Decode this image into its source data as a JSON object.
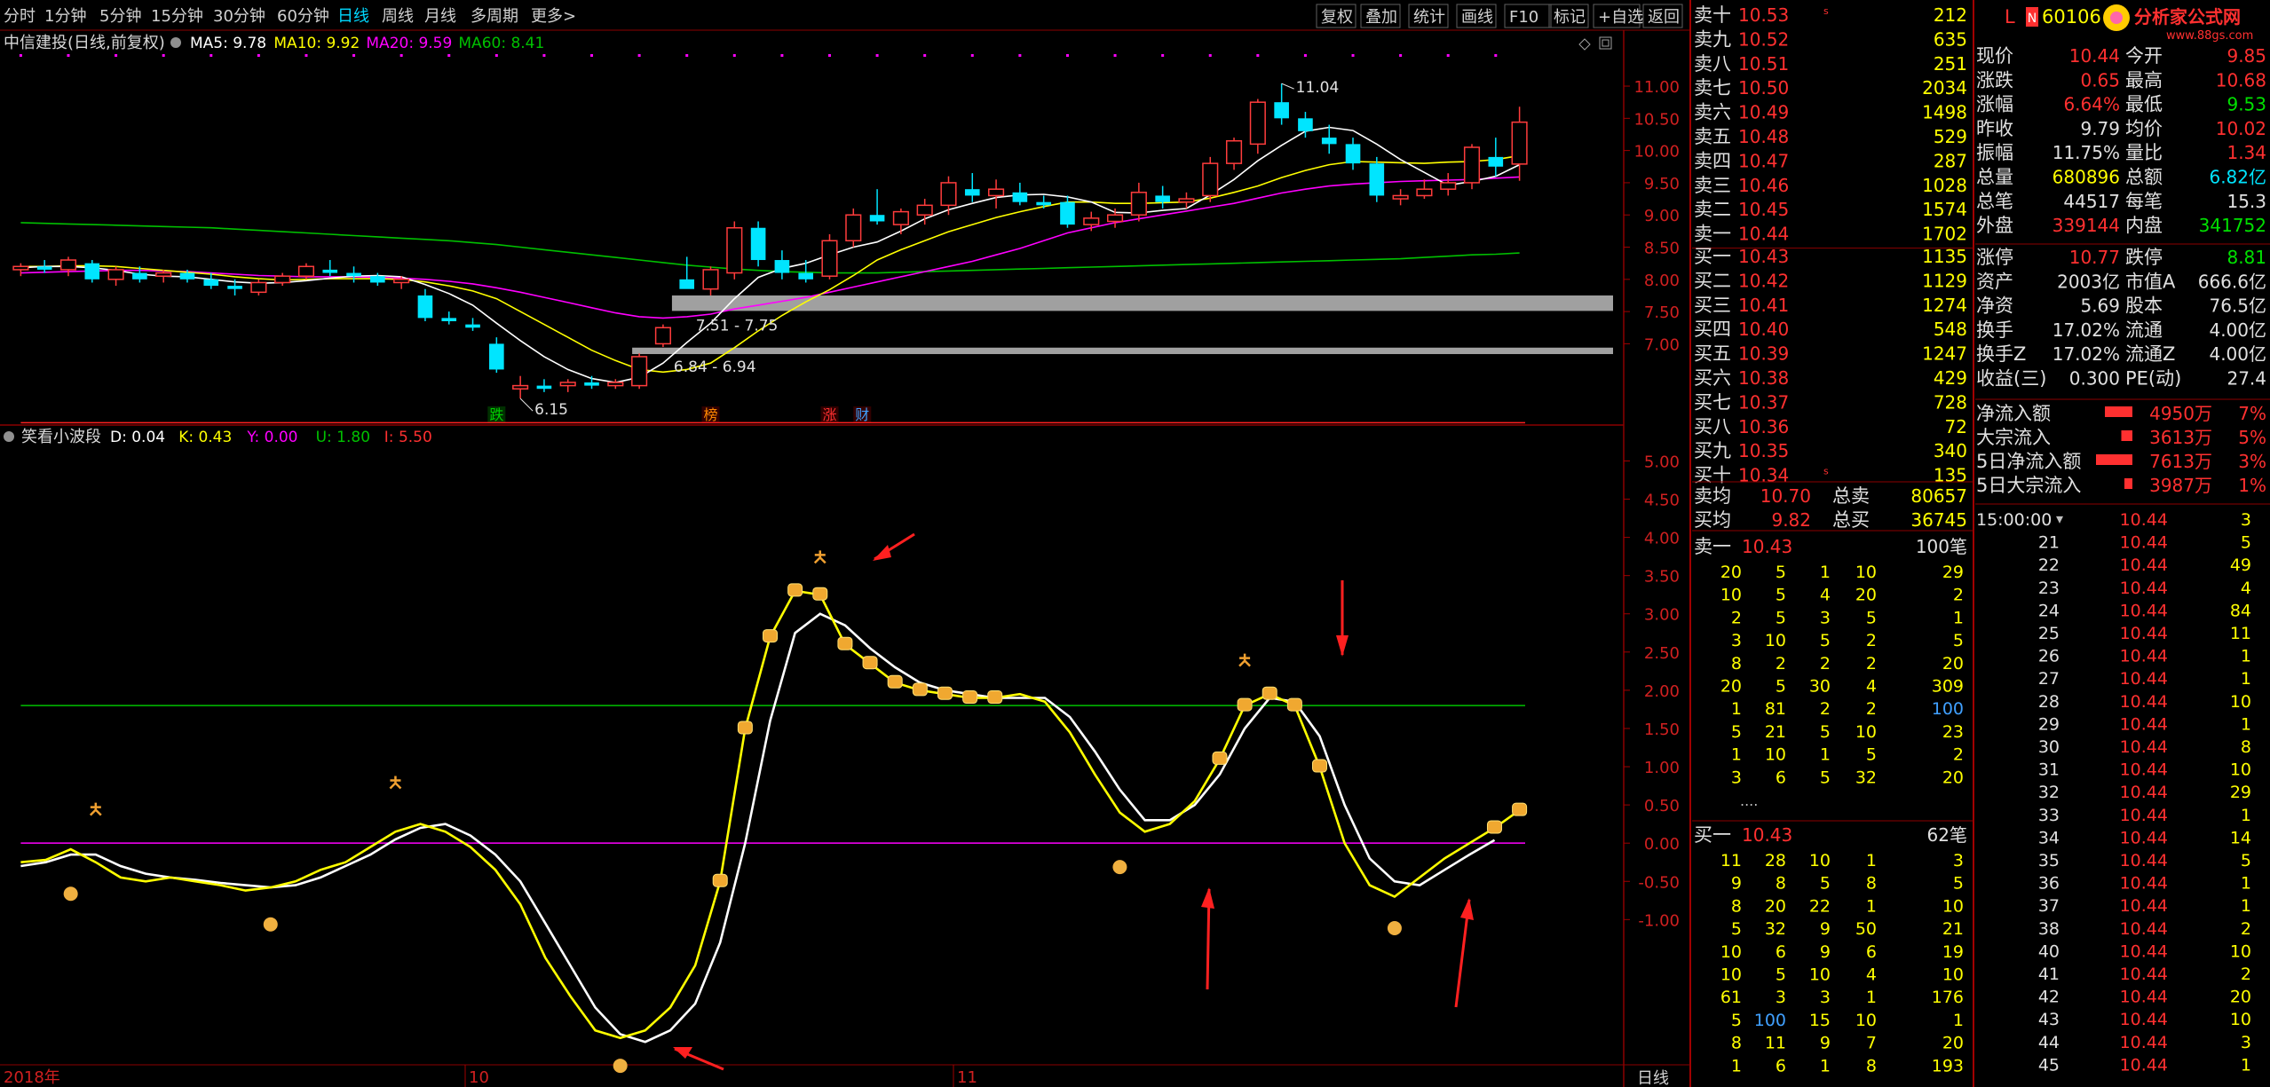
{
  "period_tabs": [
    {
      "label": "分时"
    },
    {
      "label": "1分钟"
    },
    {
      "label": "5分钟"
    },
    {
      "label": "15分钟"
    },
    {
      "label": "30分钟"
    },
    {
      "label": "60分钟"
    },
    {
      "label": "日线",
      "active": true
    },
    {
      "label": "周线"
    },
    {
      "label": "月线"
    },
    {
      "label": "多周期"
    },
    {
      "label": "更多>"
    }
  ],
  "tools": [
    {
      "label": "复权"
    },
    {
      "label": "叠加"
    },
    {
      "label": "统计"
    },
    {
      "label": "画线"
    },
    {
      "label": "F10"
    },
    {
      "label": "标记"
    },
    {
      "label": "+自选"
    },
    {
      "label": "返回"
    }
  ],
  "chart_title": "中信建投(日线,前复权)",
  "ma_legend": [
    {
      "label": "MA5: 9.78",
      "color": "#ffffff"
    },
    {
      "label": "MA10: 9.92",
      "color": "#ffff00"
    },
    {
      "label": "MA20: 9.59",
      "color": "#ff00ff"
    },
    {
      "label": "MA60: 8.41",
      "color": "#00c000"
    }
  ],
  "indicator_title": "笑看小波段",
  "indicator_legend": [
    {
      "label": "D: 0.04",
      "color": "#ffffff"
    },
    {
      "label": "K: 0.43",
      "color": "#ffff00"
    },
    {
      "label": "Y: 0.00",
      "color": "#ff00ff"
    },
    {
      "label": "U: 1.80",
      "color": "#00c000"
    },
    {
      "label": "I: 5.50",
      "color": "#ff3030"
    }
  ],
  "price_axis": [
    "11.00",
    "10.50",
    "10.00",
    "9.50",
    "9.00",
    "8.50",
    "8.00",
    "7.50",
    "7.00"
  ],
  "ind_axis": [
    "5.00",
    "4.50",
    "4.00",
    "3.50",
    "3.00",
    "2.50",
    "2.00",
    "1.50",
    "1.00",
    "0.50",
    "0.00",
    "-0.50",
    "-1.00"
  ],
  "date_axis": [
    "2018年",
    "10",
    "11"
  ],
  "period_indicator": "日线",
  "annotations": {
    "high": "11.04",
    "low": "6.15",
    "zone_upper": "7.51 - 7.75",
    "zone_lower": "6.84 - 6.94",
    "tags": [
      "跌",
      "榜",
      "涨",
      "财"
    ]
  },
  "sell_orders": [
    {
      "label": "卖十",
      "price": "10.53",
      "vol": "212",
      "flag": "s"
    },
    {
      "label": "卖九",
      "price": "10.52",
      "vol": "635"
    },
    {
      "label": "卖八",
      "price": "10.51",
      "vol": "251"
    },
    {
      "label": "卖七",
      "price": "10.50",
      "vol": "2034"
    },
    {
      "label": "卖六",
      "price": "10.49",
      "vol": "1498"
    },
    {
      "label": "卖五",
      "price": "10.48",
      "vol": "529"
    },
    {
      "label": "卖四",
      "price": "10.47",
      "vol": "287"
    },
    {
      "label": "卖三",
      "price": "10.46",
      "vol": "1028"
    },
    {
      "label": "卖二",
      "price": "10.45",
      "vol": "1574"
    },
    {
      "label": "卖一",
      "price": "10.44",
      "vol": "1702"
    }
  ],
  "buy_orders": [
    {
      "label": "买一",
      "price": "10.43",
      "vol": "1135"
    },
    {
      "label": "买二",
      "price": "10.42",
      "vol": "1129"
    },
    {
      "label": "买三",
      "price": "10.41",
      "vol": "1274"
    },
    {
      "label": "买四",
      "price": "10.40",
      "vol": "548"
    },
    {
      "label": "买五",
      "price": "10.39",
      "vol": "1247"
    },
    {
      "label": "买六",
      "price": "10.38",
      "vol": "429"
    },
    {
      "label": "买七",
      "price": "10.37",
      "vol": "728"
    },
    {
      "label": "买八",
      "price": "10.36",
      "vol": "72"
    },
    {
      "label": "买九",
      "price": "10.35",
      "vol": "340"
    },
    {
      "label": "买十",
      "price": "10.34",
      "vol": "135",
      "flag": "s"
    }
  ],
  "avg_rows": [
    {
      "label": "卖均",
      "price": "10.70",
      "tlabel": "总卖",
      "total": "80657"
    },
    {
      "label": "买均",
      "price": "9.82",
      "tlabel": "总买",
      "total": "36745"
    }
  ],
  "sell_queue": {
    "label": "卖一",
    "price": "10.43",
    "count": "100笔",
    "rows": [
      [
        "20",
        "5",
        "1",
        "10",
        "29"
      ],
      [
        "10",
        "5",
        "4",
        "20",
        "2"
      ],
      [
        "2",
        "5",
        "3",
        "5",
        "1"
      ],
      [
        "3",
        "10",
        "5",
        "2",
        "5"
      ],
      [
        "8",
        "2",
        "2",
        "2",
        "20"
      ],
      [
        "20",
        "5",
        "30",
        "4",
        "309"
      ],
      [
        "1",
        "81",
        "2",
        "2",
        "100"
      ],
      [
        "5",
        "21",
        "5",
        "10",
        "23"
      ],
      [
        "1",
        "10",
        "1",
        "5",
        "2"
      ],
      [
        "3",
        "6",
        "5",
        "32",
        "20"
      ]
    ],
    "more": "...."
  },
  "buy_queue": {
    "label": "买一",
    "price": "10.43",
    "count": "62笔",
    "rows": [
      [
        "11",
        "28",
        "10",
        "1",
        "3"
      ],
      [
        "9",
        "8",
        "5",
        "8",
        "5"
      ],
      [
        "8",
        "20",
        "22",
        "1",
        "10"
      ],
      [
        "5",
        "32",
        "9",
        "50",
        "21"
      ],
      [
        "10",
        "6",
        "9",
        "6",
        "19"
      ],
      [
        "10",
        "5",
        "10",
        "4",
        "10"
      ],
      [
        "61",
        "3",
        "3",
        "1",
        "176"
      ],
      [
        "5",
        "100",
        "15",
        "10",
        "1"
      ],
      [
        "8",
        "11",
        "9",
        "7",
        "20"
      ],
      [
        "1",
        "6",
        "1",
        "8",
        "193"
      ]
    ],
    "more": "...."
  },
  "stock": {
    "code_prefix": "L",
    "code": "60106",
    "watermark": "分析家公式网",
    "watermark_url": "www.88gs.com"
  },
  "quote_rows": [
    {
      "l1": "现价",
      "v1": "10.44",
      "c1": "#ff3030",
      "l2": "今开",
      "v2": "9.85",
      "c2": "#ff3030"
    },
    {
      "l1": "涨跌",
      "v1": "0.65",
      "c1": "#ff3030",
      "l2": "最高",
      "v2": "10.68",
      "c2": "#ff3030"
    },
    {
      "l1": "涨幅",
      "v1": "6.64%",
      "c1": "#ff3030",
      "l2": "最低",
      "v2": "9.53",
      "c2": "#00e000"
    },
    {
      "l1": "昨收",
      "v1": "9.79",
      "c1": "#e0e0e0",
      "l2": "均价",
      "v2": "10.02",
      "c2": "#ff3030"
    },
    {
      "l1": "振幅",
      "v1": "11.75%",
      "c1": "#e0e0e0",
      "l2": "量比",
      "v2": "1.34",
      "c2": "#ff3030"
    },
    {
      "l1": "总量",
      "v1": "680896",
      "c1": "#ffff00",
      "l2": "总额",
      "v2": "6.82亿",
      "c2": "#00e5ff"
    },
    {
      "l1": "总笔",
      "v1": "44517",
      "c1": "#e0e0e0",
      "l2": "每笔",
      "v2": "15.3",
      "c2": "#e0e0e0"
    },
    {
      "l1": "外盘",
      "v1": "339144",
      "c1": "#ff3030",
      "l2": "内盘",
      "v2": "341752",
      "c2": "#00e000"
    }
  ],
  "quote_rows2": [
    {
      "l1": "涨停",
      "v1": "10.77",
      "c1": "#ff3030",
      "l2": "跌停",
      "v2": "8.81",
      "c2": "#00e000"
    },
    {
      "l1": "资产",
      "v1": "2003亿",
      "c1": "#e0e0e0",
      "l2": "市值A",
      "v2": "666.6亿",
      "c2": "#e0e0e0"
    },
    {
      "l1": "净资",
      "v1": "5.69",
      "c1": "#e0e0e0",
      "l2": "股本",
      "v2": "76.5亿",
      "c2": "#e0e0e0"
    },
    {
      "l1": "换手",
      "v1": "17.02%",
      "c1": "#e0e0e0",
      "l2": "流通",
      "v2": "4.00亿",
      "c2": "#e0e0e0"
    },
    {
      "l1": "换手Z",
      "v1": "17.02%",
      "c1": "#e0e0e0",
      "l2": "流通Z",
      "v2": "4.00亿",
      "c2": "#e0e0e0"
    },
    {
      "l1": "收益(三)",
      "v1": "0.300",
      "c1": "#e0e0e0",
      "l2": "PE(动)",
      "v2": "27.4",
      "c2": "#e0e0e0"
    }
  ],
  "fund_flow": [
    {
      "label": "净流入额",
      "value": "4950万",
      "pct": "7%",
      "level": 0.62
    },
    {
      "label": "大宗流入",
      "value": "3613万",
      "pct": "5%",
      "level": 0.25
    },
    {
      "label": "5日净流入额",
      "value": "7613万",
      "pct": "3%",
      "level": 0.82
    },
    {
      "label": "5日大宗流入",
      "value": "3987万",
      "pct": "1%",
      "level": 0.18
    }
  ],
  "ticks": {
    "time": "15:00:00",
    "rows": [
      {
        "t": "",
        "p": "10.44",
        "v": "3"
      },
      {
        "t": "21",
        "p": "10.44",
        "v": "5"
      },
      {
        "t": "22",
        "p": "10.44",
        "v": "49"
      },
      {
        "t": "23",
        "p": "10.44",
        "v": "4"
      },
      {
        "t": "24",
        "p": "10.44",
        "v": "84"
      },
      {
        "t": "25",
        "p": "10.44",
        "v": "11"
      },
      {
        "t": "26",
        "p": "10.44",
        "v": "1"
      },
      {
        "t": "27",
        "p": "10.44",
        "v": "1"
      },
      {
        "t": "28",
        "p": "10.44",
        "v": "10"
      },
      {
        "t": "29",
        "p": "10.44",
        "v": "1"
      },
      {
        "t": "30",
        "p": "10.44",
        "v": "8"
      },
      {
        "t": "31",
        "p": "10.44",
        "v": "10"
      },
      {
        "t": "32",
        "p": "10.44",
        "v": "29"
      },
      {
        "t": "33",
        "p": "10.44",
        "v": "1"
      },
      {
        "t": "34",
        "p": "10.44",
        "v": "14"
      },
      {
        "t": "35",
        "p": "10.44",
        "v": "5"
      },
      {
        "t": "36",
        "p": "10.44",
        "v": "1"
      },
      {
        "t": "37",
        "p": "10.44",
        "v": "1"
      },
      {
        "t": "38",
        "p": "10.44",
        "v": "2"
      },
      {
        "t": "40",
        "p": "10.44",
        "v": "10"
      },
      {
        "t": "41",
        "p": "10.44",
        "v": "2"
      },
      {
        "t": "42",
        "p": "10.44",
        "v": "20"
      },
      {
        "t": "43",
        "p": "10.44",
        "v": "10"
      },
      {
        "t": "44",
        "p": "10.44",
        "v": "3"
      },
      {
        "t": "45",
        "p": "10.44",
        "v": "1"
      }
    ]
  },
  "chart_data": {
    "type": "candlestick",
    "ylim": [
      6.0,
      11.4
    ],
    "ohlc": [
      [
        8.15,
        8.25,
        8.05,
        8.2
      ],
      [
        8.2,
        8.3,
        8.1,
        8.15
      ],
      [
        8.15,
        8.35,
        8.05,
        8.3
      ],
      [
        8.25,
        8.3,
        7.95,
        8.0
      ],
      [
        8.0,
        8.2,
        7.9,
        8.15
      ],
      [
        8.1,
        8.2,
        7.95,
        8.0
      ],
      [
        8.05,
        8.15,
        7.95,
        8.1
      ],
      [
        8.1,
        8.15,
        7.95,
        8.0
      ],
      [
        8.0,
        8.1,
        7.85,
        7.9
      ],
      [
        7.9,
        8.0,
        7.75,
        7.85
      ],
      [
        7.8,
        8.0,
        7.75,
        7.95
      ],
      [
        7.95,
        8.1,
        7.9,
        8.05
      ],
      [
        8.05,
        8.25,
        8.0,
        8.2
      ],
      [
        8.15,
        8.3,
        8.05,
        8.1
      ],
      [
        8.1,
        8.2,
        7.95,
        8.05
      ],
      [
        8.05,
        8.1,
        7.9,
        7.95
      ],
      [
        7.95,
        8.05,
        7.85,
        8.0
      ],
      [
        7.75,
        7.85,
        7.35,
        7.4
      ],
      [
        7.4,
        7.5,
        7.3,
        7.35
      ],
      [
        7.3,
        7.4,
        7.2,
        7.25
      ],
      [
        7.0,
        7.1,
        6.55,
        6.6
      ],
      [
        6.3,
        6.5,
        6.15,
        6.35
      ],
      [
        6.35,
        6.45,
        6.25,
        6.3
      ],
      [
        6.35,
        6.45,
        6.25,
        6.4
      ],
      [
        6.4,
        6.5,
        6.3,
        6.35
      ],
      [
        6.35,
        6.45,
        6.3,
        6.4
      ],
      [
        6.35,
        6.85,
        6.3,
        6.8
      ],
      [
        7.0,
        7.3,
        6.95,
        7.25
      ],
      [
        8.0,
        8.35,
        7.9,
        7.85
      ],
      [
        7.85,
        8.2,
        7.75,
        8.15
      ],
      [
        8.1,
        8.9,
        8.0,
        8.8
      ],
      [
        8.8,
        8.9,
        8.2,
        8.3
      ],
      [
        8.3,
        8.45,
        8.0,
        8.1
      ],
      [
        8.1,
        8.3,
        7.95,
        8.0
      ],
      [
        8.05,
        8.7,
        8.0,
        8.6
      ],
      [
        8.6,
        9.1,
        8.5,
        9.0
      ],
      [
        9.0,
        9.4,
        8.85,
        8.9
      ],
      [
        8.85,
        9.1,
        8.7,
        9.05
      ],
      [
        9.0,
        9.25,
        8.85,
        9.15
      ],
      [
        9.15,
        9.6,
        9.0,
        9.5
      ],
      [
        9.4,
        9.65,
        9.2,
        9.3
      ],
      [
        9.3,
        9.55,
        9.1,
        9.4
      ],
      [
        9.35,
        9.5,
        9.15,
        9.2
      ],
      [
        9.2,
        9.3,
        9.1,
        9.15
      ],
      [
        9.2,
        9.3,
        8.8,
        8.85
      ],
      [
        8.85,
        9.05,
        8.75,
        8.95
      ],
      [
        8.9,
        9.1,
        8.8,
        9.0
      ],
      [
        9.0,
        9.5,
        8.9,
        9.35
      ],
      [
        9.3,
        9.45,
        9.1,
        9.2
      ],
      [
        9.2,
        9.35,
        9.1,
        9.25
      ],
      [
        9.3,
        9.9,
        9.2,
        9.8
      ],
      [
        9.8,
        10.2,
        9.7,
        10.15
      ],
      [
        10.1,
        10.8,
        9.95,
        10.75
      ],
      [
        10.75,
        11.04,
        10.4,
        10.5
      ],
      [
        10.5,
        10.6,
        10.2,
        10.3
      ],
      [
        10.2,
        10.4,
        9.95,
        10.1
      ],
      [
        10.1,
        10.2,
        9.7,
        9.8
      ],
      [
        9.8,
        9.9,
        9.2,
        9.3
      ],
      [
        9.25,
        9.4,
        9.15,
        9.3
      ],
      [
        9.3,
        9.55,
        9.25,
        9.4
      ],
      [
        9.4,
        9.65,
        9.3,
        9.5
      ],
      [
        9.5,
        10.1,
        9.4,
        10.05
      ],
      [
        9.9,
        10.2,
        9.6,
        9.75
      ],
      [
        9.79,
        10.68,
        9.53,
        10.44
      ]
    ],
    "ma5": [
      8.18,
      8.2,
      8.2,
      8.18,
      8.14,
      8.08,
      8.05,
      8.04,
      8.0,
      7.96,
      7.94,
      7.95,
      7.98,
      8.02,
      8.05,
      8.06,
      8.04,
      7.92,
      7.78,
      7.6,
      7.32,
      7.05,
      6.8,
      6.6,
      6.46,
      6.4,
      6.48,
      6.7,
      7.02,
      7.32,
      7.7,
      8.03,
      8.17,
      8.25,
      8.38,
      8.5,
      8.58,
      8.75,
      8.94,
      9.08,
      9.18,
      9.27,
      9.31,
      9.32,
      9.28,
      9.2,
      9.04,
      9.03,
      9.07,
      9.1,
      9.31,
      9.55,
      9.84,
      10.08,
      10.3,
      10.36,
      10.31,
      10.1,
      9.86,
      9.66,
      9.46,
      9.52,
      9.6,
      9.78
    ],
    "ma10": [
      8.2,
      8.2,
      8.21,
      8.21,
      8.2,
      8.17,
      8.14,
      8.11,
      8.08,
      8.04,
      8.01,
      7.99,
      8.0,
      8.01,
      8.01,
      8.01,
      8.0,
      7.96,
      7.9,
      7.82,
      7.7,
      7.5,
      7.3,
      7.1,
      6.9,
      6.74,
      6.6,
      6.56,
      6.6,
      6.7,
      6.94,
      7.2,
      7.44,
      7.65,
      7.84,
      8.06,
      8.3,
      8.46,
      8.6,
      8.74,
      8.85,
      8.96,
      9.05,
      9.13,
      9.2,
      9.2,
      9.18,
      9.18,
      9.19,
      9.2,
      9.26,
      9.35,
      9.45,
      9.58,
      9.69,
      9.78,
      9.83,
      9.82,
      9.81,
      9.8,
      9.82,
      9.83,
      9.86,
      9.92
    ],
    "ma20": [
      8.1,
      8.11,
      8.12,
      8.13,
      8.14,
      8.14,
      8.13,
      8.12,
      8.1,
      8.08,
      8.06,
      8.05,
      8.04,
      8.04,
      8.04,
      8.03,
      8.02,
      8.0,
      7.97,
      7.93,
      7.87,
      7.8,
      7.72,
      7.64,
      7.56,
      7.48,
      7.42,
      7.4,
      7.42,
      7.46,
      7.54,
      7.6,
      7.66,
      7.72,
      7.8,
      7.88,
      7.96,
      8.04,
      8.12,
      8.2,
      8.28,
      8.38,
      8.48,
      8.6,
      8.72,
      8.8,
      8.88,
      8.94,
      9.0,
      9.06,
      9.12,
      9.18,
      9.26,
      9.34,
      9.4,
      9.45,
      9.48,
      9.5,
      9.52,
      9.53,
      9.54,
      9.55,
      9.57,
      9.59
    ],
    "ma60": [
      8.88,
      8.87,
      8.86,
      8.85,
      8.84,
      8.83,
      8.82,
      8.81,
      8.8,
      8.78,
      8.76,
      8.74,
      8.72,
      8.7,
      8.68,
      8.66,
      8.64,
      8.62,
      8.6,
      8.57,
      8.54,
      8.5,
      8.46,
      8.42,
      8.38,
      8.34,
      8.3,
      8.26,
      8.22,
      8.19,
      8.16,
      8.14,
      8.12,
      8.11,
      8.1,
      8.1,
      8.1,
      8.11,
      8.12,
      8.13,
      8.14,
      8.15,
      8.16,
      8.17,
      8.18,
      8.19,
      8.2,
      8.21,
      8.22,
      8.23,
      8.24,
      8.25,
      8.26,
      8.27,
      8.28,
      8.29,
      8.3,
      8.31,
      8.32,
      8.34,
      8.36,
      8.38,
      8.39,
      8.41
    ],
    "indicator": {
      "ylim": [
        -2.9,
        5.4
      ],
      "K": [
        -0.25,
        -0.22,
        -0.08,
        -0.25,
        -0.45,
        -0.5,
        -0.45,
        -0.5,
        -0.55,
        -0.62,
        -0.58,
        -0.5,
        -0.35,
        -0.25,
        -0.05,
        0.15,
        0.25,
        0.15,
        -0.05,
        -0.35,
        -0.8,
        -1.5,
        -2.0,
        -2.45,
        -2.55,
        -2.45,
        -2.15,
        -1.6,
        -0.5,
        1.5,
        2.7,
        3.3,
        3.25,
        2.6,
        2.35,
        2.1,
        2.0,
        1.95,
        1.9,
        1.9,
        1.95,
        1.85,
        1.45,
        0.9,
        0.4,
        0.15,
        0.25,
        0.55,
        1.1,
        1.8,
        1.95,
        1.8,
        1.0,
        0.0,
        -0.55,
        -0.7,
        -0.45,
        -0.2,
        0.0,
        0.2,
        0.43
      ],
      "D": [
        -0.3,
        -0.25,
        -0.15,
        -0.15,
        -0.3,
        -0.4,
        -0.45,
        -0.48,
        -0.52,
        -0.55,
        -0.58,
        -0.55,
        -0.45,
        -0.3,
        -0.15,
        0.05,
        0.2,
        0.25,
        0.1,
        -0.15,
        -0.5,
        -1.05,
        -1.6,
        -2.15,
        -2.5,
        -2.6,
        -2.45,
        -2.1,
        -1.3,
        0.0,
        1.6,
        2.75,
        3.0,
        2.85,
        2.55,
        2.3,
        2.1,
        2.0,
        1.95,
        1.9,
        1.9,
        1.9,
        1.65,
        1.2,
        0.7,
        0.3,
        0.3,
        0.5,
        0.9,
        1.5,
        1.9,
        1.85,
        1.4,
        0.5,
        -0.2,
        -0.5,
        -0.55,
        -0.35,
        -0.15,
        0.04
      ],
      "Y": 0.0,
      "U": 1.8,
      "I": 5.5
    }
  }
}
